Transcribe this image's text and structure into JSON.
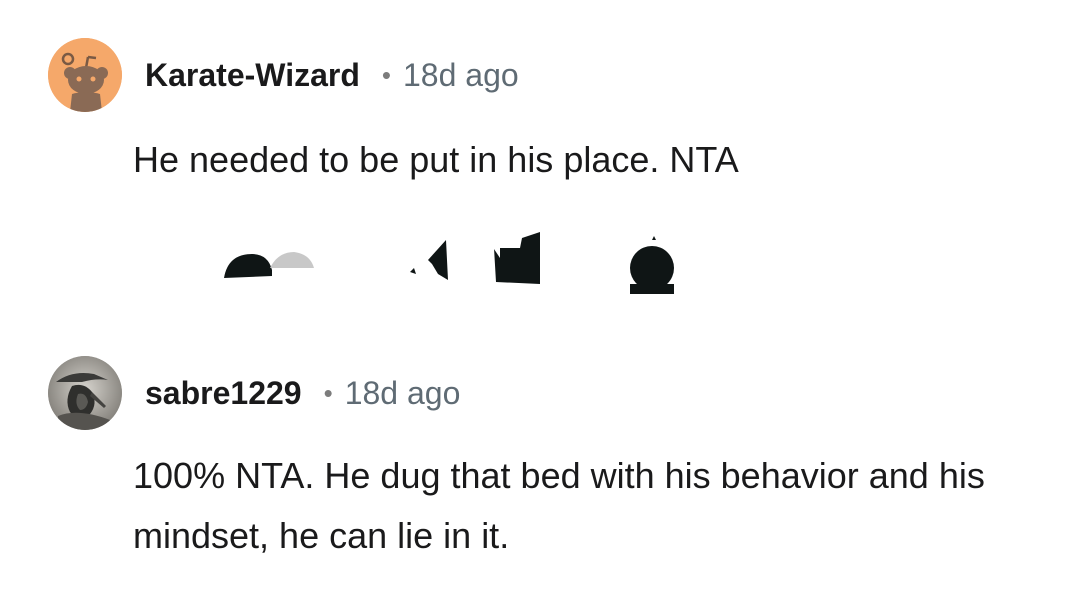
{
  "comments": [
    {
      "username": "Karate-Wizard",
      "separator": "•",
      "timestamp": "18d ago",
      "body": "He needed to be put in his place. NTA",
      "avatar_icon": "snoo-avatar-icon",
      "avatar_color": "#f5a86a"
    },
    {
      "username": "sabre1229",
      "separator": "•",
      "timestamp": "18d ago",
      "body": "100% NTA. He dug that bed with his behavior and his mindset, he can lie in it.",
      "avatar_icon": "photo-avatar-icon",
      "avatar_color": "#a9a6a1"
    }
  ],
  "colors": {
    "text": "#1a1a1b",
    "muted": "#5f6b74",
    "background": "#ffffff"
  }
}
